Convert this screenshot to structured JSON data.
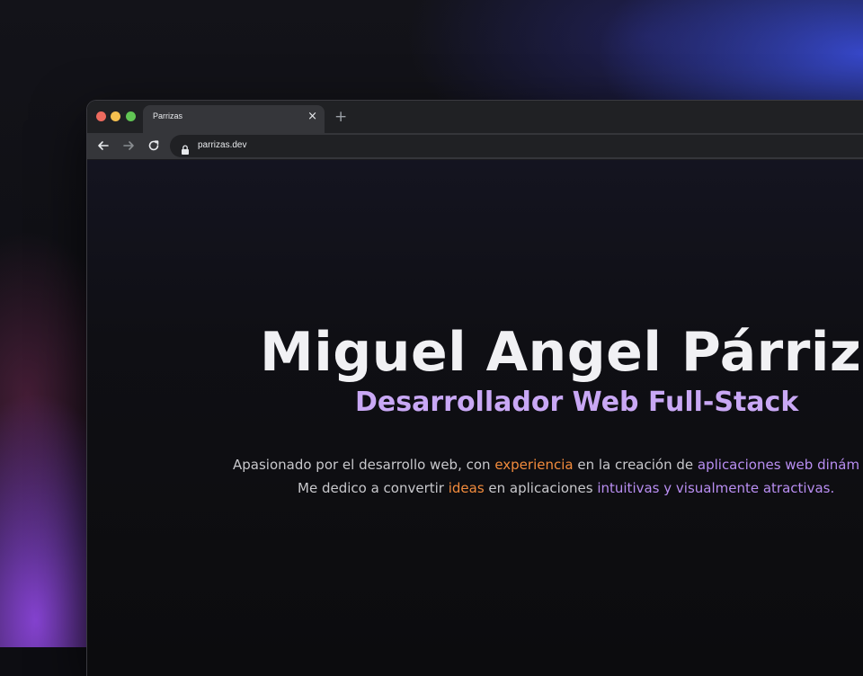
{
  "browser": {
    "tab_title": "Parrizas",
    "tab_close": "×",
    "new_tab": "+",
    "url": "parrizas.dev"
  },
  "hero": {
    "name": "Miguel Angel Párrizas",
    "role": "Desarrollador Web Full-Stack",
    "bio_line1": {
      "t1": "Apasionado por el desarrollo web, con ",
      "h1": "experiencia",
      "t2": " en la creación de ",
      "h2": "aplicaciones web dinám"
    },
    "bio_line2": {
      "t1": "Me dedico a convertir ",
      "h1": "ideas",
      "t2": " en aplicaciones ",
      "h2": "intuitivas y visualmente atractivas."
    }
  },
  "colors": {
    "accent_purple": "#c9a8f5",
    "accent_orange": "#f28b3c",
    "highlight_purple": "#b98ef2"
  }
}
